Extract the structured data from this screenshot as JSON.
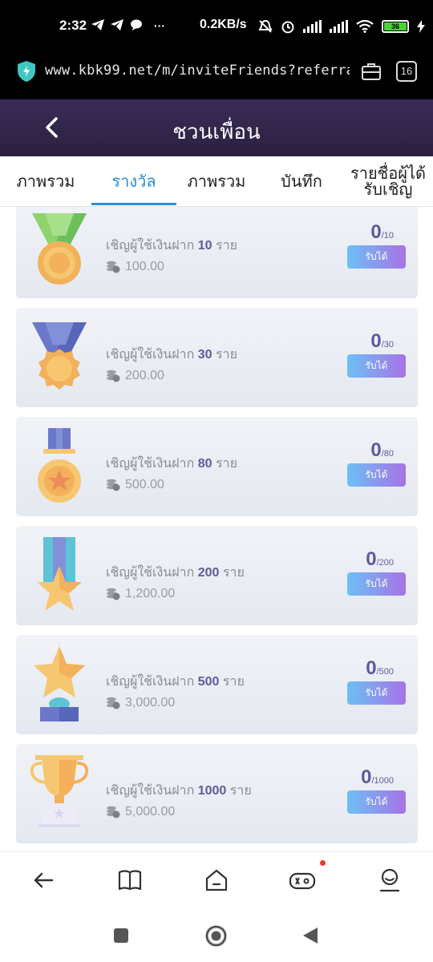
{
  "status_bar": {
    "time": "2:32",
    "network_speed": "0.2KB/s",
    "battery_level": "36",
    "icons": [
      "telegram-icon",
      "telegram-icon",
      "chat-icon",
      "more-dots-icon",
      "mute-icon",
      "alarm-icon",
      "signal-icon",
      "signal-icon",
      "wifi-icon",
      "battery-icon"
    ]
  },
  "browser": {
    "url": "www.kbk99.net/m/inviteFriends?referra",
    "tab_count": "16"
  },
  "header": {
    "title": "ชวนเพื่อน"
  },
  "tabs": [
    {
      "label": "ภาพรวม"
    },
    {
      "label": "รางวัล"
    },
    {
      "label": "ภาพรวม"
    },
    {
      "label": "บันทึก"
    },
    {
      "label": "รายชื่อผู้ได้รับเชิญ"
    }
  ],
  "rewards": [
    {
      "prefix": "เชิญผู้ใช้เงินฝาก",
      "count": "10",
      "suffix": "ราย",
      "amount": "100.00",
      "progress": "0",
      "target": "/10",
      "button": "รับได้",
      "medal": "medal-green-ribbon"
    },
    {
      "prefix": "เชิญผู้ใช้เงินฝาก",
      "count": "30",
      "suffix": "ราย",
      "amount": "200.00",
      "progress": "0",
      "target": "/30",
      "button": "รับได้",
      "medal": "medal-blue-ribbon"
    },
    {
      "prefix": "เชิญผู้ใช้เงินฝาก",
      "count": "80",
      "suffix": "ราย",
      "amount": "500.00",
      "progress": "0",
      "target": "/80",
      "button": "รับได้",
      "medal": "medal-star-gold"
    },
    {
      "prefix": "เชิญผู้ใช้เงินฝาก",
      "count": "200",
      "suffix": "ราย",
      "amount": "1,200.00",
      "progress": "0",
      "target": "/200",
      "button": "รับได้",
      "medal": "medal-star-ribbon"
    },
    {
      "prefix": "เชิญผู้ใช้เงินฝาก",
      "count": "500",
      "suffix": "ราย",
      "amount": "3,000.00",
      "progress": "0",
      "target": "/500",
      "button": "รับได้",
      "medal": "star-trophy"
    },
    {
      "prefix": "เชิญผู้ใช้เงินฝาก",
      "count": "1000",
      "suffix": "ราย",
      "amount": "5,000.00",
      "progress": "0",
      "target": "/1000",
      "button": "รับได้",
      "medal": "gold-cup-trophy"
    }
  ],
  "bottom_nav": [
    "back-arrow-icon",
    "book-icon",
    "home-icon",
    "gamepad-icon",
    "profile-icon"
  ],
  "system_nav": [
    "recents-icon",
    "home-circle-icon",
    "back-triangle-icon"
  ],
  "colors": {
    "header_bg": "#2b2040",
    "active_tab": "#2b8fd6",
    "accent_text": "#5e5a9c",
    "button_gradient_start": "#6cc0f5",
    "button_gradient_end": "#a673e6"
  }
}
